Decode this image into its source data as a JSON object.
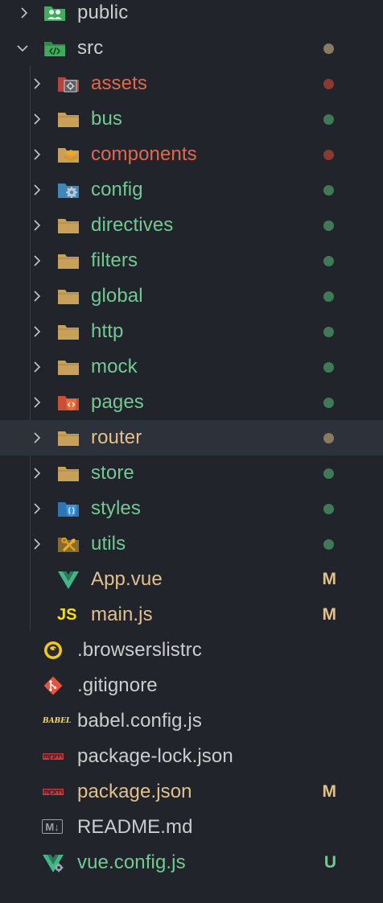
{
  "colors": {
    "background": "#21252b",
    "untracked_green": "#73c991",
    "modified_tan": "#e2c08d",
    "conflict_red": "#e2674f",
    "plain_text": "#cccccc",
    "folder_tan": "#c8a05a",
    "dot_green": "#3f7a55",
    "dot_red": "#8a3b31",
    "dot_tan": "#8a7a63"
  },
  "tree": {
    "public": {
      "label": "public",
      "icon": "people-folder-icon"
    },
    "src": {
      "label": "src",
      "icon": "code-folder-icon"
    },
    "assets": {
      "label": "assets",
      "icon": "assets-folder-icon"
    },
    "bus": {
      "label": "bus",
      "icon": "folder-icon"
    },
    "components": {
      "label": "components",
      "icon": "components-folder-icon"
    },
    "config": {
      "label": "config",
      "icon": "gear-folder-icon"
    },
    "directives": {
      "label": "directives",
      "icon": "folder-icon"
    },
    "filters": {
      "label": "filters",
      "icon": "folder-icon"
    },
    "global": {
      "label": "global",
      "icon": "folder-icon"
    },
    "http": {
      "label": "http",
      "icon": "folder-icon"
    },
    "mock": {
      "label": "mock",
      "icon": "folder-icon"
    },
    "pages": {
      "label": "pages",
      "icon": "html-folder-icon"
    },
    "router": {
      "label": "router",
      "icon": "folder-icon"
    },
    "store": {
      "label": "store",
      "icon": "folder-icon"
    },
    "styles": {
      "label": "styles",
      "icon": "css-folder-icon"
    },
    "utils": {
      "label": "utils",
      "icon": "tools-folder-icon"
    },
    "app_vue": {
      "label": "App.vue",
      "icon": "vue-icon",
      "badge": "M"
    },
    "main_js": {
      "label": "main.js",
      "icon": "js-icon",
      "icon_text": "JS",
      "badge": "M"
    },
    "browserslistrc": {
      "label": ".browserslistrc",
      "icon": "browserslist-icon"
    },
    "gitignore": {
      "label": ".gitignore",
      "icon": "git-icon"
    },
    "babel_config": {
      "label": "babel.config.js",
      "icon": "babel-icon",
      "icon_text": "BABEL"
    },
    "package_lock": {
      "label": "package-lock.json",
      "icon": "npm-icon"
    },
    "package_json": {
      "label": "package.json",
      "icon": "npm-icon",
      "badge": "M"
    },
    "readme": {
      "label": "README.md",
      "icon": "markdown-icon",
      "icon_text": "M↓"
    },
    "vue_config": {
      "label": "vue.config.js",
      "icon": "vue-config-icon",
      "badge": "U"
    }
  }
}
